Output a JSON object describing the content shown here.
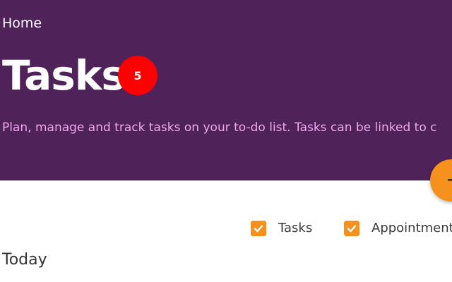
{
  "breadcrumb": {
    "home": "Home"
  },
  "header": {
    "title": "Tasks",
    "count_badge": "5",
    "description": "Plan, manage and track tasks on your to-do list. Tasks can be linked to c"
  },
  "fab": {
    "icon": "plus-icon",
    "label": "+"
  },
  "filters": [
    {
      "label": "Tasks",
      "checked": true
    },
    {
      "label": "Appointments",
      "checked": true
    }
  ],
  "sections": {
    "today": "Today"
  },
  "colors": {
    "header_bg": "#4f2259",
    "accent": "#f6911e",
    "badge": "#ff0000",
    "description_text": "#f0a8f0"
  }
}
